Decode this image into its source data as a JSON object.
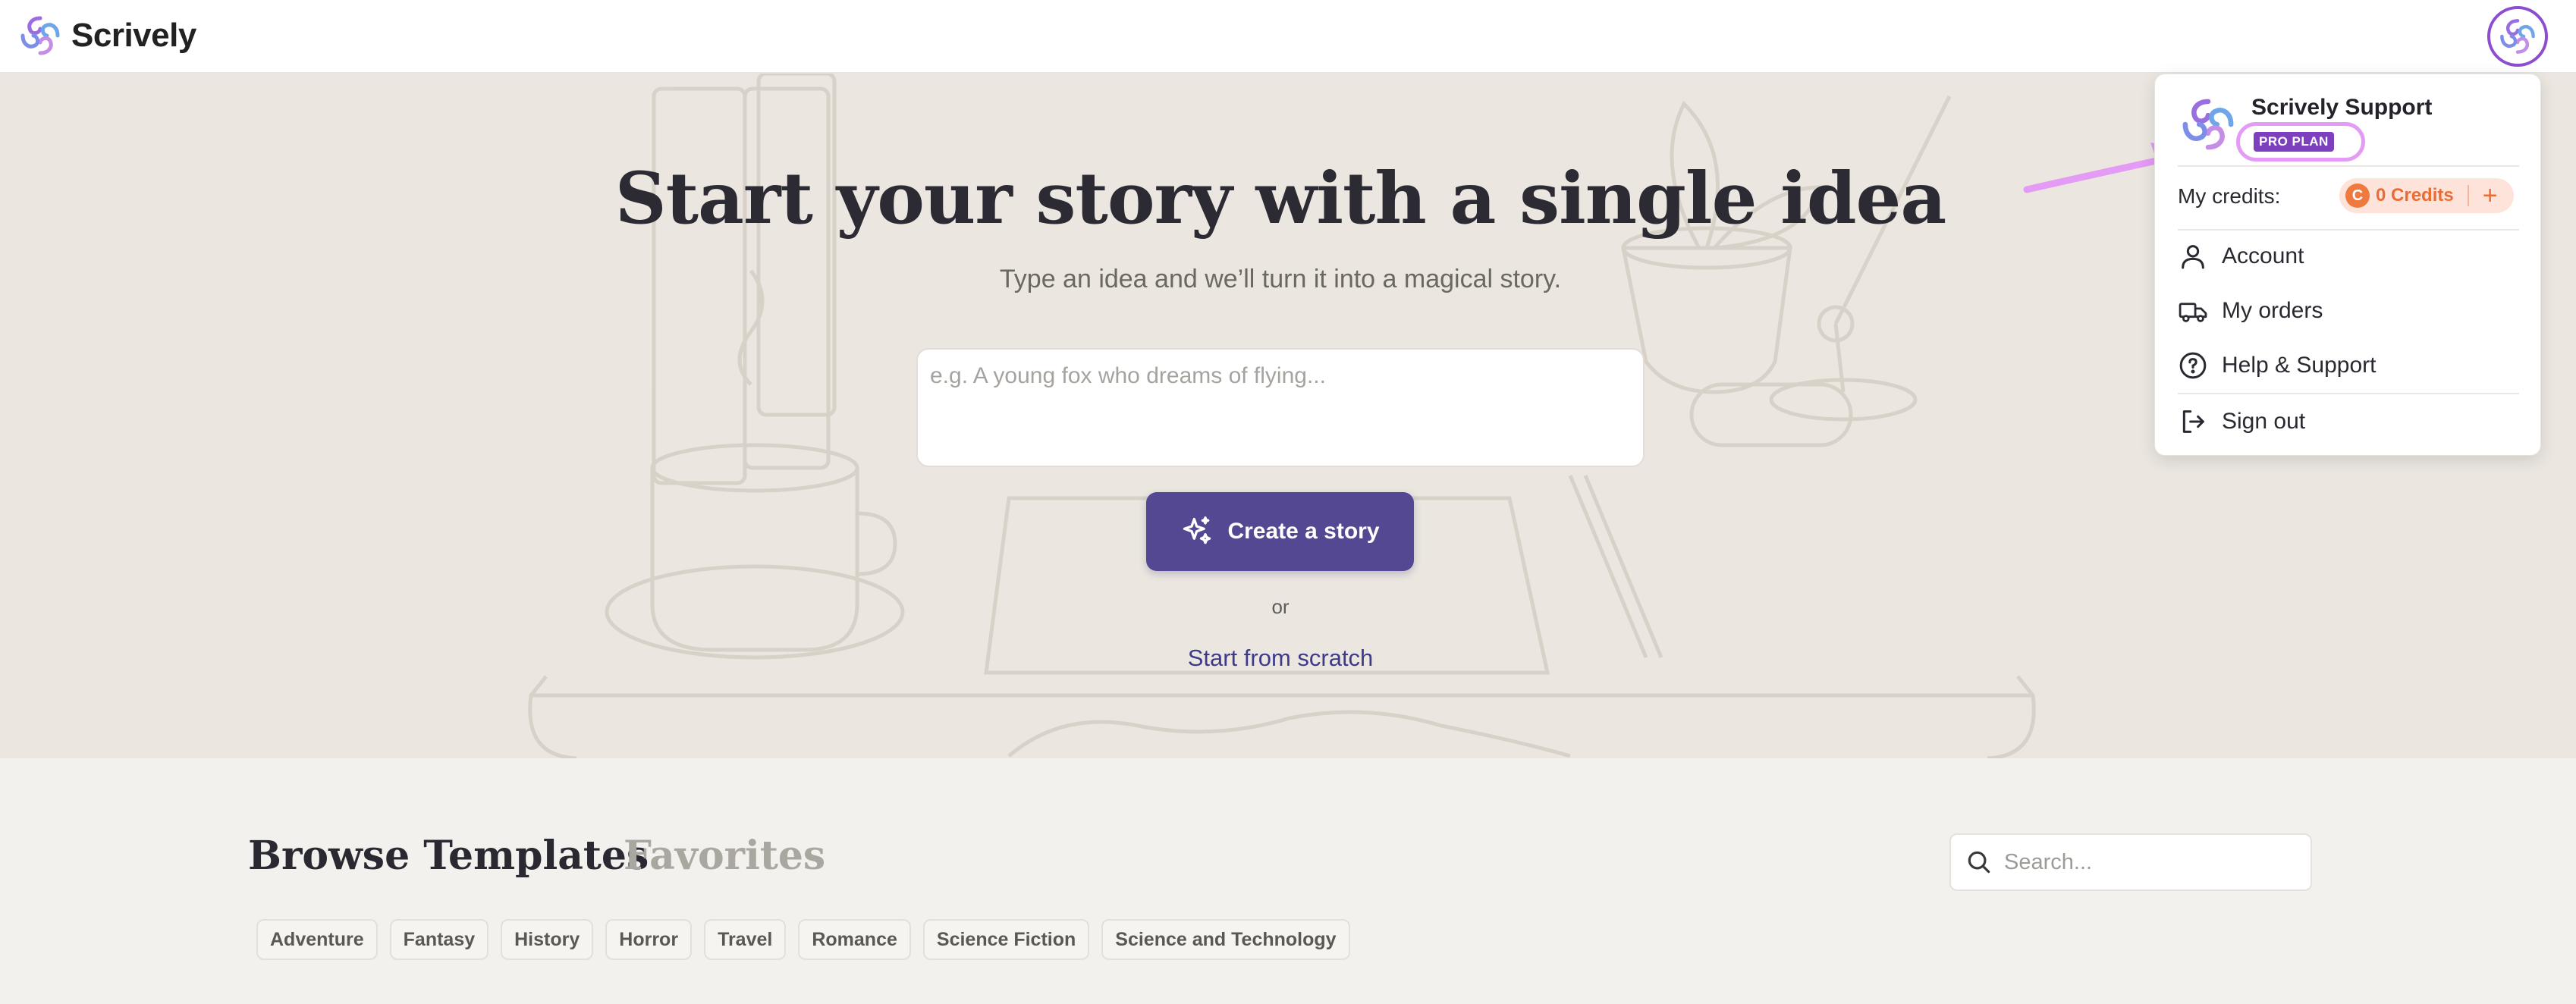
{
  "app": {
    "name": "Scrively"
  },
  "hero": {
    "title": "Start your story with a single idea",
    "subtitle": "Type an idea and we’ll turn it into a magical story.",
    "idea_placeholder": "e.g. A young fox who dreams of flying...",
    "create_label": "Create a story",
    "or_label": "or",
    "scratch_label": "Start from scratch"
  },
  "browse": {
    "tabs": [
      {
        "label": "Browse Templates",
        "active": true
      },
      {
        "label": "Favorites",
        "active": false
      }
    ],
    "search_placeholder": "Search...",
    "categories": [
      "Adventure",
      "Fantasy",
      "History",
      "Horror",
      "Travel",
      "Romance",
      "Science Fiction",
      "Science and Technology"
    ]
  },
  "user_menu": {
    "name": "Scrively Support",
    "plan_badge": "PRO PLAN",
    "credits_label": "My credits:",
    "credits_value": "0 Credits",
    "credits_icon": "C",
    "items": [
      {
        "label": "Account",
        "icon": "user-icon"
      },
      {
        "label": "My orders",
        "icon": "truck-icon"
      },
      {
        "label": "Help & Support",
        "icon": "help-circle-icon"
      },
      {
        "label": "Sign out",
        "icon": "sign-out-icon"
      }
    ]
  },
  "colors": {
    "brand_purple": "#544893",
    "accent_violet": "#8c4ecf",
    "credits_orange": "#ea6c35",
    "annotation_pink": "#e39bf5"
  }
}
